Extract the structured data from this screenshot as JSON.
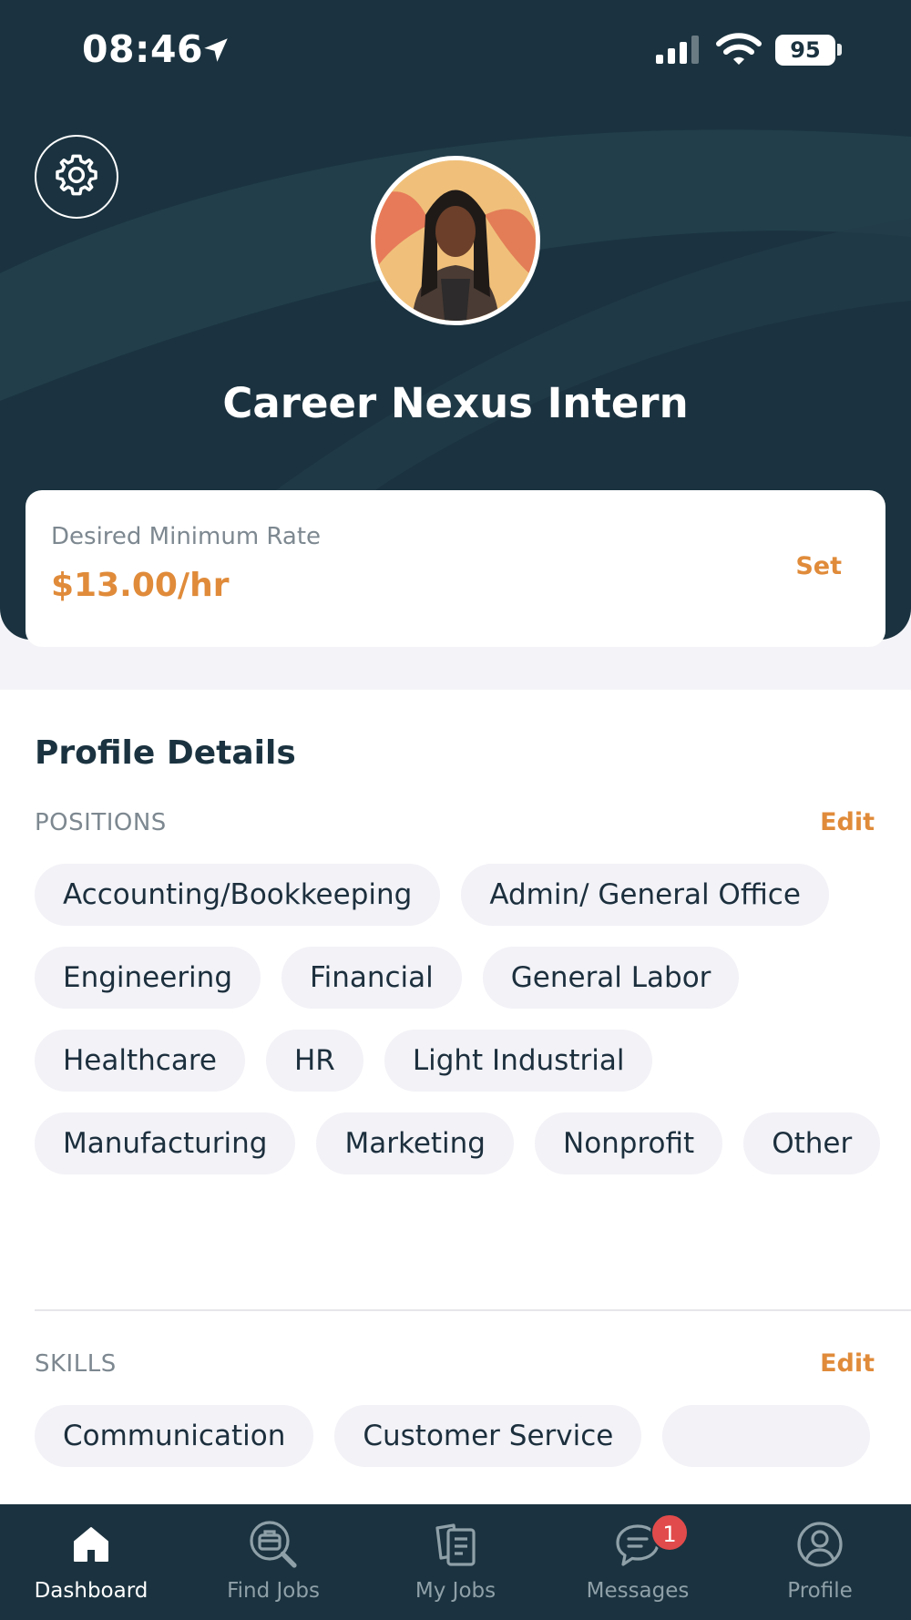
{
  "status_bar": {
    "time": "08:46",
    "battery": "95"
  },
  "profile": {
    "name": "Career Nexus Intern"
  },
  "rate": {
    "label": "Desired Minimum Rate",
    "value": "$13.00/hr",
    "action": "Set"
  },
  "details": {
    "title": "Profile Details",
    "positions": {
      "label": "POSITIONS",
      "edit": "Edit",
      "items": [
        "Accounting/Bookkeeping",
        "Admin/ General Office",
        "Engineering",
        "Financial",
        "General Labor",
        "Healthcare",
        "HR",
        "Light Industrial",
        "Manufacturing",
        "Marketing",
        "Nonprofit",
        "Other"
      ]
    },
    "skills": {
      "label": "SKILLS",
      "edit": "Edit",
      "items": [
        "Communication",
        "Customer Service"
      ]
    }
  },
  "tabbar": {
    "items": [
      {
        "label": "Dashboard",
        "icon": "home-icon"
      },
      {
        "label": "Find Jobs",
        "icon": "briefcase-search-icon"
      },
      {
        "label": "My Jobs",
        "icon": "documents-icon"
      },
      {
        "label": "Messages",
        "icon": "chat-icon",
        "badge": "1"
      },
      {
        "label": "Profile",
        "icon": "user-icon"
      }
    ]
  },
  "colors": {
    "header": "#1b3340",
    "accent": "#e08b3a",
    "chip": "#f2f2f7",
    "badge": "#e24b4b"
  }
}
